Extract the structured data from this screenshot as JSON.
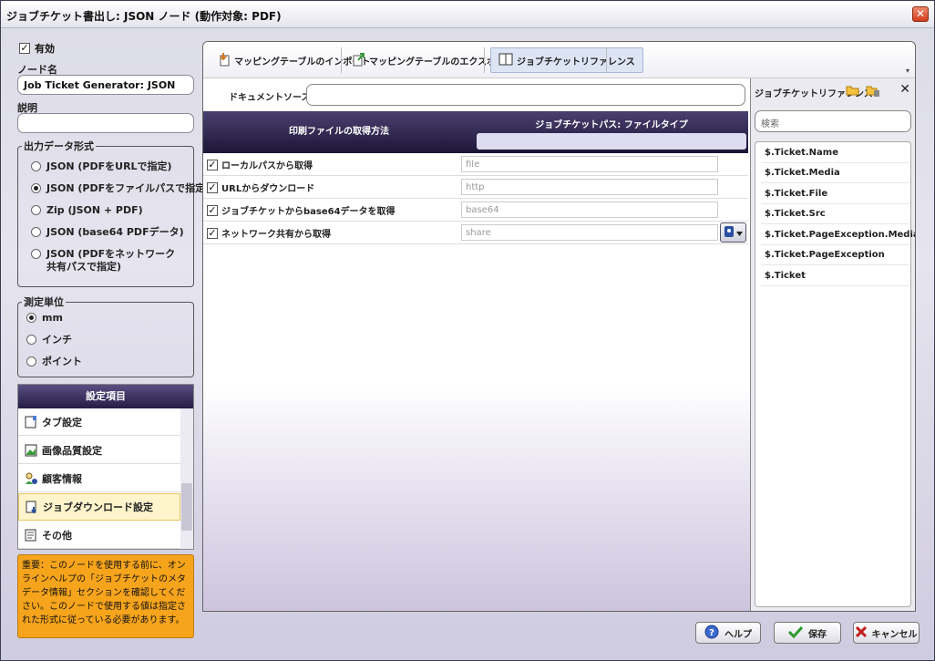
{
  "window": {
    "title": "ジョブチケット書出し: JSON ノード (動作対象: PDF)",
    "close_glyph": "✕"
  },
  "left": {
    "enabled_label": "有効",
    "enabled_checked": true,
    "node_name_label": "ノード名",
    "node_name_value": "Job Ticket Generator: JSON",
    "description_label": "説明",
    "description_value": "",
    "output_format": {
      "legend": "出力データ形式",
      "options": [
        {
          "label": "JSON (PDFをURLで指定)",
          "selected": false
        },
        {
          "label": "JSON (PDFをファイルパスで指定)",
          "selected": true
        },
        {
          "label": "Zip (JSON + PDF)",
          "selected": false
        },
        {
          "label": "JSON (base64 PDFデータ)",
          "selected": false
        },
        {
          "label": "JSON (PDFをネットワーク共有パスで指定)",
          "selected": false
        }
      ]
    },
    "units": {
      "legend": "測定単位",
      "options": [
        {
          "label": "mm",
          "selected": true
        },
        {
          "label": "インチ",
          "selected": false
        },
        {
          "label": "ポイント",
          "selected": false
        }
      ]
    },
    "settings": {
      "header": "設定項目",
      "items": [
        {
          "label": "タブ設定",
          "icon": "tab-icon",
          "selected": false
        },
        {
          "label": "画像品質設定",
          "icon": "image-icon",
          "selected": false
        },
        {
          "label": "顧客情報",
          "icon": "customer-icon",
          "selected": false
        },
        {
          "label": "ジョブダウンロード設定",
          "icon": "download-icon",
          "selected": true
        },
        {
          "label": "その他",
          "icon": "other-icon",
          "selected": false
        }
      ]
    },
    "note": "重要：このノードを使用する前に、オンラインヘルプの「ジョブチケットのメタデータ情報」セクションを確認してください。このノードで使用する値は指定された形式に従っている必要があります。"
  },
  "toolbar": {
    "import_label": "マッピングテーブルのインポート",
    "export_label": "マッピングテーブルのエクスポート",
    "reference_label": "ジョブチケットリファレンス"
  },
  "main": {
    "doc_source_label": "ドキュメントソース",
    "doc_source_value": "",
    "col1_header": "印刷ファイルの取得方法",
    "col2_header": "ジョブチケットパス: ファイルタイプ",
    "rows": [
      {
        "label": "ローカルパスから取得",
        "checked": true,
        "placeholder": "file"
      },
      {
        "label": "URLからダウンロード",
        "checked": true,
        "placeholder": "http"
      },
      {
        "label": "ジョブチケットからbase64データを取得",
        "checked": true,
        "placeholder": "base64"
      },
      {
        "label": "ネットワーク共有から取得",
        "checked": true,
        "placeholder": "share"
      }
    ]
  },
  "reference": {
    "title": "ジョブチケットリファレンス",
    "search_placeholder": "検索",
    "items": [
      "$.Ticket.Name",
      "$.Ticket.Media",
      "$.Ticket.File",
      "$.Ticket.Src",
      "$.Ticket.PageException.Media",
      "$.Ticket.PageException",
      "$.Ticket"
    ]
  },
  "buttons": {
    "help": "ヘルプ",
    "save": "保存",
    "cancel": "キャンセル"
  }
}
